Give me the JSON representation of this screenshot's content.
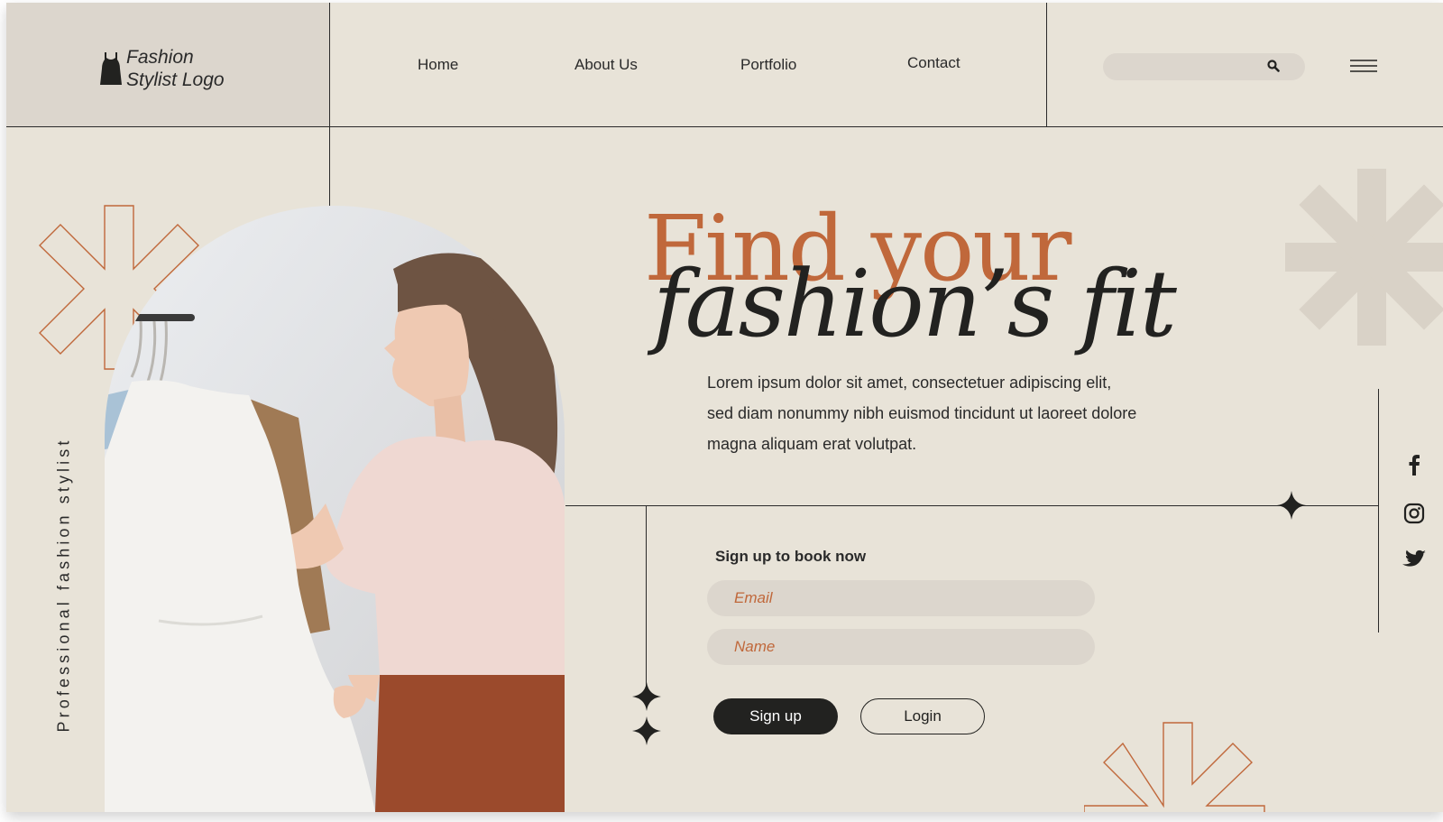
{
  "header": {
    "logo_line1": "Fashion",
    "logo_line2": "Stylist Logo",
    "nav": [
      "Home",
      "About Us",
      "Portfolio",
      "Contact"
    ],
    "search_placeholder": ""
  },
  "hero": {
    "side_label": "Professional fashion stylist",
    "headline_line1": "Find your",
    "headline_line2": "fashion’s fit",
    "paragraph": [
      "Lorem ipsum dolor sit amet, consectetuer adipiscing elit,",
      "sed diam nonummy nibh euismod tincidunt ut laoreet dolore",
      "magna aliquam erat volutpat."
    ]
  },
  "signup": {
    "title": "Sign up to book now",
    "email_placeholder": "Email",
    "name_placeholder": "Name",
    "signup_label": "Sign up",
    "login_label": "Login"
  },
  "social": [
    "facebook-icon",
    "instagram-icon",
    "twitter-icon"
  ],
  "colors": {
    "background": "#e8e3d8",
    "panel": "#dcd6cd",
    "accent": "#c0683b",
    "dark": "#222220"
  }
}
